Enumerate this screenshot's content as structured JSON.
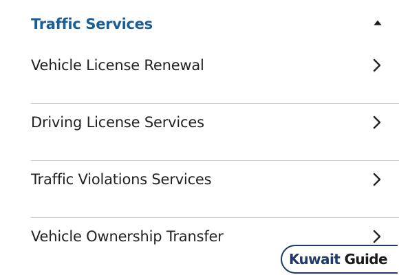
{
  "section": {
    "title": "Traffic Services",
    "expanded": true,
    "icon": "caret-up-icon"
  },
  "items": [
    {
      "label": "Vehicle License Renewal",
      "icon": "chevron-right-icon"
    },
    {
      "label": "Driving License Services",
      "icon": "chevron-right-icon"
    },
    {
      "label": "Traffic Violations Services",
      "icon": "chevron-right-icon"
    },
    {
      "label": "Vehicle Ownership Transfer",
      "icon": "chevron-right-icon"
    }
  ],
  "watermark": {
    "word1": "Kuwait",
    "word2": "Guide"
  },
  "colors": {
    "title": "#1a5e96",
    "text": "#222222",
    "divider": "#cfcfcf",
    "icon": "#222222",
    "watermark_border": "#1f3a68"
  }
}
